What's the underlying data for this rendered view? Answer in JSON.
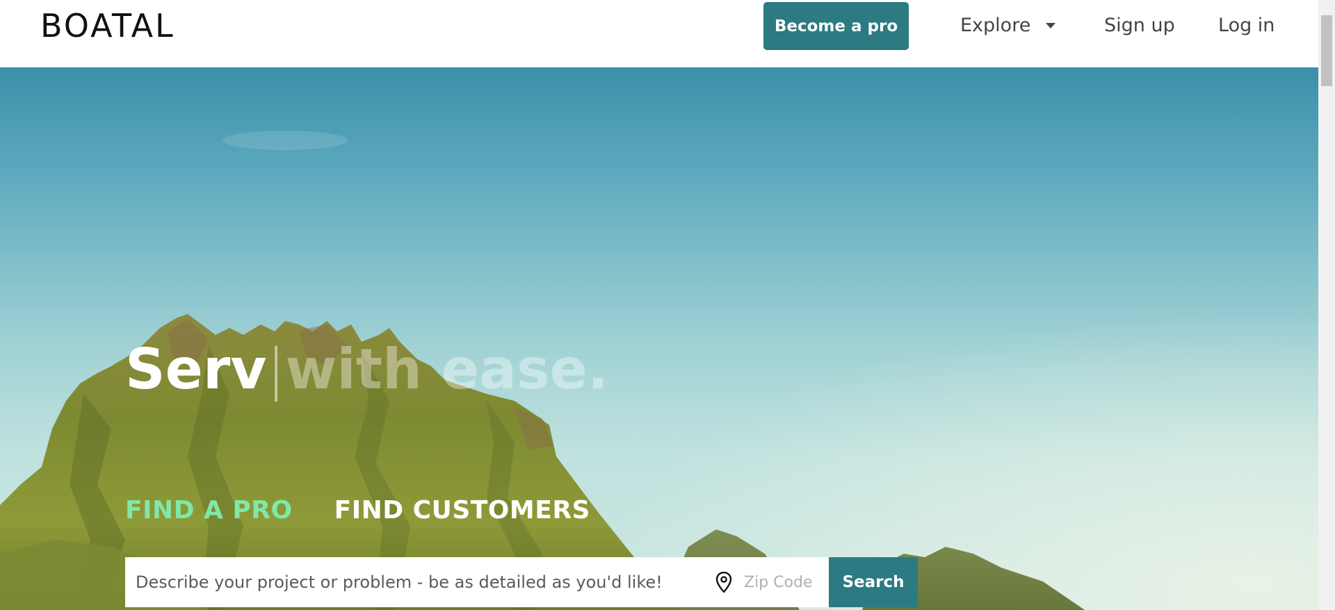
{
  "header": {
    "logo": "BOATAL",
    "become_pro_label": "Become a pro",
    "nav": {
      "explore": "Explore",
      "signup": "Sign up",
      "login": "Log in"
    }
  },
  "hero": {
    "headline_typed": "Serv",
    "headline_cursor": "|",
    "headline_rest": "with ease.",
    "tabs": [
      {
        "label": "FIND A PRO",
        "active": true
      },
      {
        "label": "FIND CUSTOMERS",
        "active": false
      }
    ],
    "search": {
      "project_placeholder": "Describe your project or problem - be as detailed as you'd like!",
      "zip_placeholder": "Zip Code",
      "button_label": "Search"
    }
  },
  "colors": {
    "brand_teal": "#2c7a82",
    "active_tab": "#7fe8a8"
  },
  "icons": [
    "caret-down-icon",
    "map-pin-icon"
  ]
}
